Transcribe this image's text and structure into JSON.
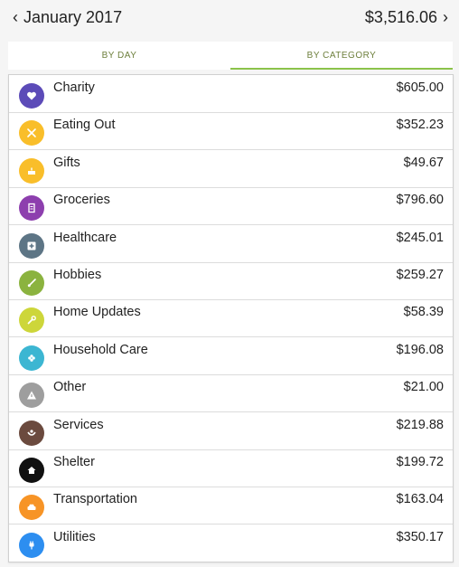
{
  "header": {
    "prev_label": "‹",
    "next_label": "›",
    "month": "January 2017",
    "total": "$3,516.06"
  },
  "tabs": [
    {
      "label": "BY DAY",
      "active": false
    },
    {
      "label": "BY CATEGORY",
      "active": true
    }
  ],
  "accent_color": "#8bc34a",
  "categories": [
    {
      "name": "Charity",
      "amount": "$605.00",
      "color": "#5c4bb8",
      "icon": "heart-icon"
    },
    {
      "name": "Eating Out",
      "amount": "$352.23",
      "color": "#f9be2a",
      "icon": "utensils-icon"
    },
    {
      "name": "Gifts",
      "amount": "$49.67",
      "color": "#f9be2a",
      "icon": "cake-icon"
    },
    {
      "name": "Groceries",
      "amount": "$796.60",
      "color": "#8d3fae",
      "icon": "receipt-icon"
    },
    {
      "name": "Healthcare",
      "amount": "$245.01",
      "color": "#5d7585",
      "icon": "medical-plus-icon"
    },
    {
      "name": "Hobbies",
      "amount": "$259.27",
      "color": "#8bb33f",
      "icon": "brush-icon"
    },
    {
      "name": "Home Updates",
      "amount": "$58.39",
      "color": "#cdd63a",
      "icon": "wrench-icon"
    },
    {
      "name": "Household Care",
      "amount": "$196.08",
      "color": "#3cb6d2",
      "icon": "flower-icon"
    },
    {
      "name": "Other",
      "amount": "$21.00",
      "color": "#9e9e9e",
      "icon": "warning-icon"
    },
    {
      "name": "Services",
      "amount": "$219.88",
      "color": "#6b4a3e",
      "icon": "hand-icon"
    },
    {
      "name": "Shelter",
      "amount": "$199.72",
      "color": "#111111",
      "icon": "home-icon"
    },
    {
      "name": "Transportation",
      "amount": "$163.04",
      "color": "#f79426",
      "icon": "car-icon"
    },
    {
      "name": "Utilities",
      "amount": "$350.17",
      "color": "#2d8ef0",
      "icon": "plug-icon"
    }
  ]
}
